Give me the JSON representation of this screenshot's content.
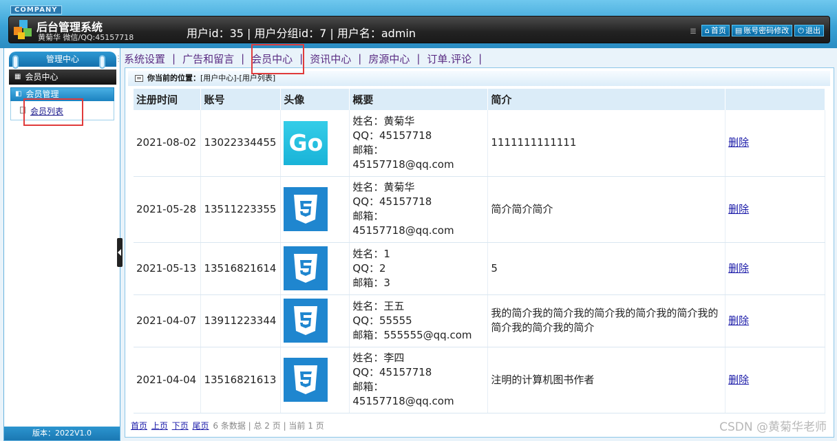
{
  "header": {
    "company": "COMPANY",
    "title": "后台管理系统",
    "subtitle": "黄菊华 微信/QQ:45157718",
    "user_info": "用户id：35 | 用户分组id：7 | 用户名：admin",
    "buttons": [
      {
        "label": "首页",
        "icon": "home-icon"
      },
      {
        "label": "账号密码修改",
        "icon": "document-icon"
      },
      {
        "label": "退出",
        "icon": "power-icon"
      }
    ]
  },
  "sidebar": {
    "title": "管理中心",
    "section": "会员中心",
    "group": "会员管理",
    "link": "会员列表",
    "version": "版本：2022V1.0"
  },
  "menu": {
    "items": [
      "系统设置",
      "广告和留言",
      "会员中心",
      "资讯中心",
      "房源中心",
      "订单.评论"
    ]
  },
  "breadcrumb": {
    "label": "你当前的位置：",
    "path": "[用户中心]-[用户列表]"
  },
  "table": {
    "headers": [
      "注册时间",
      "账号",
      "头像",
      "概要",
      "简介",
      ""
    ],
    "rows": [
      {
        "date": "2021-08-02",
        "account": "13022334455",
        "avatar": "Go",
        "avatar_type": "go",
        "name": "姓名：黄菊华",
        "qq": "QQ：45157718",
        "email": "邮箱：45157718@qq.com",
        "intro": "1111111111111",
        "action": "删除"
      },
      {
        "date": "2021-05-28",
        "account": "13511223355",
        "avatar": "css3",
        "avatar_type": "css",
        "name": "姓名：黄菊华",
        "qq": "QQ：45157718",
        "email": "邮箱：45157718@qq.com",
        "intro": "简介简介简介",
        "action": "删除"
      },
      {
        "date": "2021-05-13",
        "account": "13516821614",
        "avatar": "css3",
        "avatar_type": "css",
        "name": "姓名：1",
        "qq": "QQ：2",
        "email": "邮箱：3",
        "intro": "5",
        "action": "删除"
      },
      {
        "date": "2021-04-07",
        "account": "13911223344",
        "avatar": "css3",
        "avatar_type": "css",
        "name": "姓名：王五",
        "qq": "QQ：55555",
        "email": "邮箱：555555@qq.com",
        "intro": "我的简介我的简介我的简介我的简介我的简介我的简介我的简介我的简介",
        "action": "删除"
      },
      {
        "date": "2021-04-04",
        "account": "13516821613",
        "avatar": "css3",
        "avatar_type": "css",
        "name": "姓名：李四",
        "qq": "QQ：45157718",
        "email": "邮箱：45157718@qq.com",
        "intro": "注明的计算机图书作者",
        "action": "删除"
      }
    ]
  },
  "pager": {
    "first": "首页",
    "prev": "上页",
    "next": "下页",
    "last": "尾页",
    "info": "6 条数据 | 总 2 页 | 当前 1 页"
  },
  "watermark": "CSDN @黄菊华老师",
  "colors": {
    "accent": "#1f86cf",
    "header": "#3aa2d6",
    "highlight": "#e03a3a"
  }
}
